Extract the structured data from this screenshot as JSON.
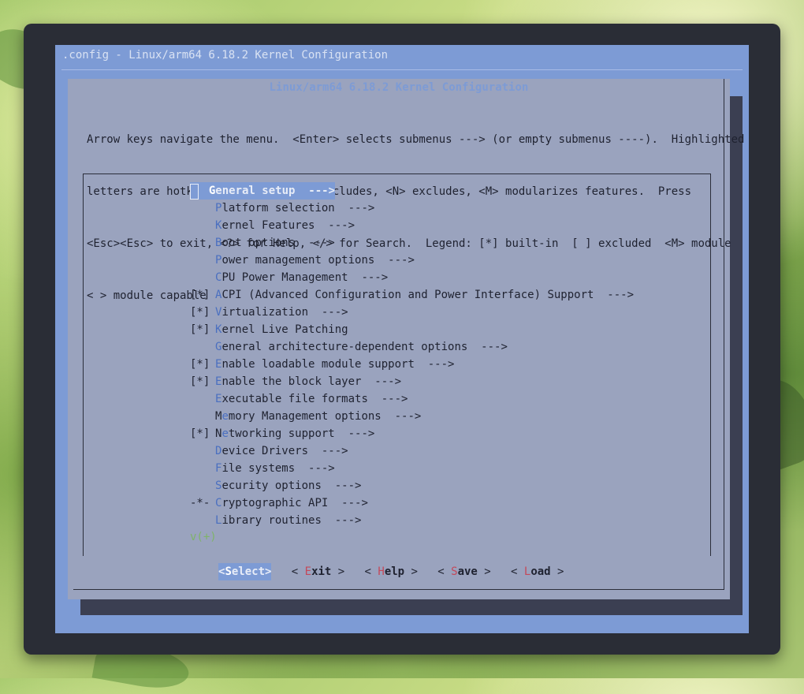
{
  "window": {
    "backtitle": ".config - Linux/arm64 6.18.2 Kernel Configuration",
    "dialog_title": "Linux/arm64 6.18.2 Kernel Configuration"
  },
  "help_lines": [
    "Arrow keys navigate the menu.  <Enter> selects submenus ---> (or empty submenus ----).  Highlighted",
    "letters are hotkeys.  Pressing <Y> includes, <N> excludes, <M> modularizes features.  Press",
    "<Esc><Esc> to exit, <?> for Help, </> for Search.  Legend: [*] built-in  [ ] excluded  <M> module",
    "< > module capable"
  ],
  "menu": [
    {
      "mark": "",
      "pre": "",
      "hk": "G",
      "post": "eneral setup  --->",
      "selected": true
    },
    {
      "mark": "",
      "pre": "",
      "hk": "P",
      "post": "latform selection  --->"
    },
    {
      "mark": "",
      "pre": "",
      "hk": "K",
      "post": "ernel Features  --->"
    },
    {
      "mark": "",
      "pre": "",
      "hk": "B",
      "post": "oot options  --->"
    },
    {
      "mark": "",
      "pre": "",
      "hk": "P",
      "post": "ower management options  --->"
    },
    {
      "mark": "",
      "pre": "",
      "hk": "C",
      "post": "PU Power Management  --->"
    },
    {
      "mark": "[*]",
      "pre": "",
      "hk": "A",
      "post": "CPI (Advanced Configuration and Power Interface) Support  --->"
    },
    {
      "mark": "[*]",
      "pre": "",
      "hk": "V",
      "post": "irtualization  --->"
    },
    {
      "mark": "[*]",
      "pre": "",
      "hk": "K",
      "post": "ernel Live Patching"
    },
    {
      "mark": "",
      "pre": "",
      "hk": "G",
      "post": "eneral architecture-dependent options  --->"
    },
    {
      "mark": "[*]",
      "pre": "",
      "hk": "E",
      "post": "nable loadable module support  --->"
    },
    {
      "mark": "[*]",
      "pre": "",
      "hk": "E",
      "post": "nable the block layer  --->"
    },
    {
      "mark": "",
      "pre": "",
      "hk": "E",
      "post": "xecutable file formats  --->"
    },
    {
      "mark": "",
      "pre": "M",
      "hk": "e",
      "post": "mory Management options  --->"
    },
    {
      "mark": "[*]",
      "pre": "N",
      "hk": "e",
      "post": "tworking support  --->"
    },
    {
      "mark": "",
      "pre": "",
      "hk": "D",
      "post": "evice Drivers  --->"
    },
    {
      "mark": "",
      "pre": "",
      "hk": "F",
      "post": "ile systems  --->"
    },
    {
      "mark": "",
      "pre": "",
      "hk": "S",
      "post": "ecurity options  --->"
    },
    {
      "mark": "-*-",
      "pre": "",
      "hk": "C",
      "post": "ryptographic API  --->"
    },
    {
      "mark": "",
      "pre": "",
      "hk": "L",
      "post": "ibrary routines  --->"
    }
  ],
  "more_indicator": "v(+)",
  "buttons": [
    {
      "open": "<",
      "hk": "S",
      "rest": "elect",
      "close": ">",
      "active": true
    },
    {
      "open": "< ",
      "hk": "E",
      "rest": "xit",
      "close": " >"
    },
    {
      "open": "< ",
      "hk": "H",
      "rest": "elp",
      "close": " >"
    },
    {
      "open": "< ",
      "hk": "S",
      "rest": "ave",
      "close": " >"
    },
    {
      "open": "< ",
      "hk": "L",
      "rest": "oad",
      "close": " >"
    }
  ],
  "colors": {
    "terminal_bg": "#7d9bd5",
    "dialog_bg": "#9aa3be",
    "hotkey": "#4a6fc0",
    "button_hotkey": "#c4495a"
  }
}
